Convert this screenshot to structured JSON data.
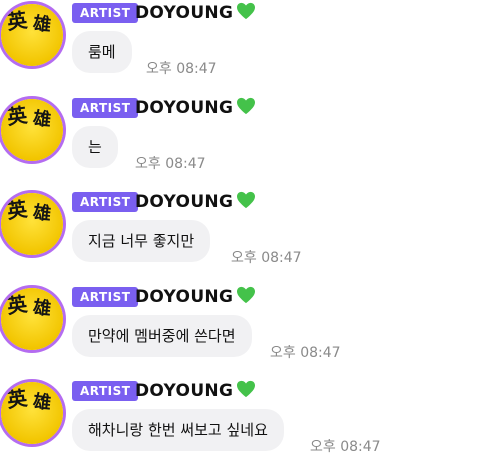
{
  "badge_label": "ARTIST",
  "sender_name": "DOYOUNG",
  "heart_color": "#44c24a",
  "badge_color": "#7a5ff0",
  "bubble_color": "#f1f1f3",
  "avatar_text": "英雄",
  "messages": [
    {
      "text": "룸메",
      "time": "오후 08:47"
    },
    {
      "text": "는",
      "time": "오후 08:47"
    },
    {
      "text": "지금 너무 좋지만",
      "time": "오후 08:47"
    },
    {
      "text": "만약에 멤버중에 쓴다면",
      "time": "오후 08:47"
    },
    {
      "text": "해차니랑 한번 써보고 싶네요",
      "time": "오후 08:47"
    }
  ]
}
